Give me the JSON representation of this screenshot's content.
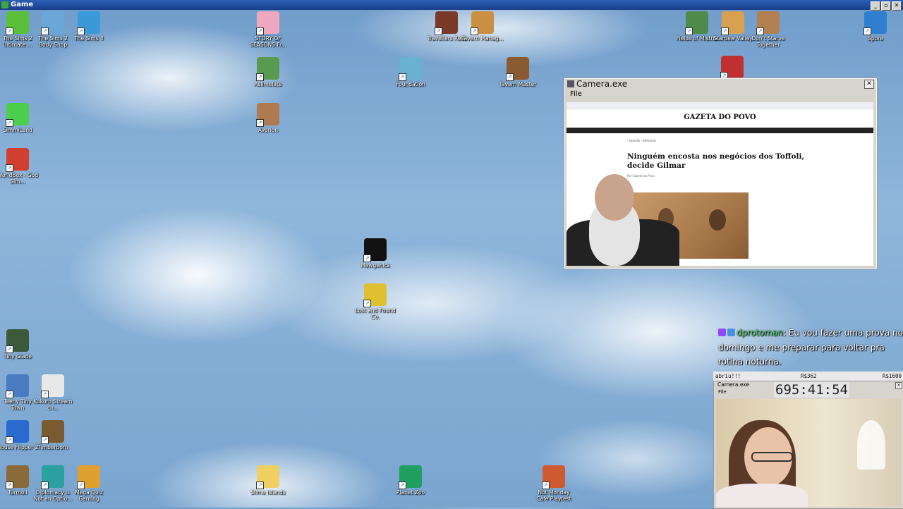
{
  "window": {
    "title": "Game"
  },
  "desktop": {
    "icons": [
      {
        "label": "The Sims 2 Ultimate ...",
        "icon": "sims-plumbob-icon",
        "color": "#5cbf3a"
      },
      {
        "label": "The Sims 2 Body Shop",
        "icon": "sims-body-shop-icon",
        "color": "#6aa7d8"
      },
      {
        "label": "The Sims 4",
        "icon": "sims-4-icon",
        "color": "#3a9ad9"
      },
      {
        "label": "STORY OF SEASONS Fr...",
        "icon": "cow-icon",
        "color": "#f0a8c0"
      },
      {
        "label": "Travellers Rest",
        "icon": "tavern-sign-icon",
        "color": "#7a3a2a"
      },
      {
        "label": "Tavern Manag...",
        "icon": "beer-mug-icon",
        "color": "#c89040"
      },
      {
        "label": "Fields of Mistria",
        "icon": "mistria-icon",
        "color": "#4e8a4a"
      },
      {
        "label": "Stardew Valley",
        "icon": "chicken-icon",
        "color": "#d9a050"
      },
      {
        "label": "Don't Starve Together",
        "icon": "dont-starve-icon",
        "color": "#b08050"
      },
      {
        "label": "Spore",
        "icon": "spore-icon",
        "color": "#2e7fd0"
      },
      {
        "label": "Aslimelate",
        "icon": "slime-icon",
        "color": "#5a9a50"
      },
      {
        "label": "Foundation",
        "icon": "windmill-icon",
        "color": "#6ab0d0"
      },
      {
        "label": "Tavern Master",
        "icon": "tavern-master-icon",
        "color": "#8a5a30"
      },
      {
        "label": "SimmiLand",
        "icon": "simmiland-icon",
        "color": "#4ccf4c"
      },
      {
        "label": "Avorion",
        "icon": "avorion-icon",
        "color": "#b07a50"
      },
      {
        "label": "WorldBox - God Sim...",
        "icon": "worldbox-icon",
        "color": "#d04030"
      },
      {
        "label": "Mewgenics",
        "icon": "paw-icon",
        "color": "#111111"
      },
      {
        "label": "Lost and Found Co.",
        "icon": "lost-and-found-icon",
        "color": "#e0c030"
      },
      {
        "label": "Tiny Glade",
        "icon": "sheep-icon",
        "color": "#3a5a3a"
      },
      {
        "label": "Teeny Tiny Town",
        "icon": "teeny-tiny-town-icon",
        "color": "#4a7abf"
      },
      {
        "label": "Kukoro Stream ch...",
        "icon": "kukoro-icon",
        "color": "#e8e8e8"
      },
      {
        "label": "House Flipper 2",
        "icon": "house-flipper-icon",
        "color": "#2a6acf"
      },
      {
        "label": "Timberborn",
        "icon": "beaver-icon",
        "color": "#7a5a30"
      },
      {
        "label": "Turmoil",
        "icon": "oil-derrick-icon",
        "color": "#8a6a3a"
      },
      {
        "label": "Diplomacy is Not an Optio...",
        "icon": "diplomacy-icon",
        "color": "#2aa0a0"
      },
      {
        "label": "Mega Quiz Gaming",
        "icon": "mega-quiz-icon",
        "color": "#e0a030"
      },
      {
        "label": "Slime Islands",
        "icon": "puzzle-icon",
        "color": "#f0d060"
      },
      {
        "label": "Planet Zoo",
        "icon": "planet-zoo-icon",
        "color": "#1fa060"
      },
      {
        "label": "Not Monday Cafe Playtest",
        "icon": "cafe-icon",
        "color": "#d05a30"
      },
      {
        "label": "",
        "icon": "campfire-icon",
        "color": "#c03030"
      }
    ]
  },
  "camera_window": {
    "title": "Camera.exe",
    "menu": "File",
    "close": "✕",
    "article": {
      "site": "GAZETA DO POVO",
      "breadcrumb": "› Opinião › Editoriais",
      "headline": "Ninguém encosta nos negócios dos Toffoli, decide Gilmar",
      "byline": "Por Gazeta do Povo"
    }
  },
  "chat": {
    "username": "dprotoman",
    "message": ": Eu vou fazer uma prova no domingo e me preparar para voltar pra rotina noturna."
  },
  "ticker": {
    "left": "abriu!!!",
    "middle": "R$362",
    "right": "R$1600"
  },
  "camera_window_small": {
    "title": "Camera.exe",
    "menu": "File",
    "close": "✕",
    "timer": "695:41:54"
  },
  "titlebar_buttons": {
    "minimize": "_",
    "maximize": "▫",
    "close": "✕"
  }
}
